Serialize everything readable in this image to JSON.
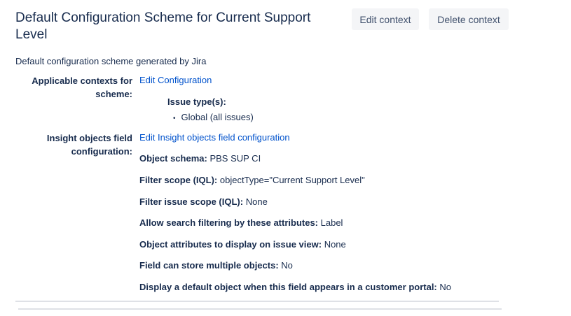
{
  "title": "Default Configuration Scheme for Current Support Level",
  "buttons": {
    "edit_context": "Edit context",
    "delete_context": "Delete context"
  },
  "description": "Default configuration scheme generated by Jira",
  "contexts": {
    "label": "Applicable contexts for scheme:",
    "link": "Edit Configuration",
    "issue_types_label": "Issue type(s):",
    "issue_types": [
      "Global (all issues)"
    ]
  },
  "insight": {
    "label": "Insight objects field configuration:",
    "link": "Edit Insight objects field configuration",
    "fields": [
      {
        "label": "Object schema:",
        "value": "PBS SUP CI"
      },
      {
        "label": "Filter scope (IQL):",
        "value": "objectType=\"Current Support Level\""
      },
      {
        "label": "Filter issue scope (IQL):",
        "value": "None"
      },
      {
        "label": "Allow search filtering by these attributes:",
        "value": "Label"
      },
      {
        "label": "Object attributes to display on issue view:",
        "value": "None"
      },
      {
        "label": "Field can store multiple objects:",
        "value": "No"
      },
      {
        "label": "Display a default object when this field appears in a customer portal:",
        "value": "No"
      }
    ]
  }
}
